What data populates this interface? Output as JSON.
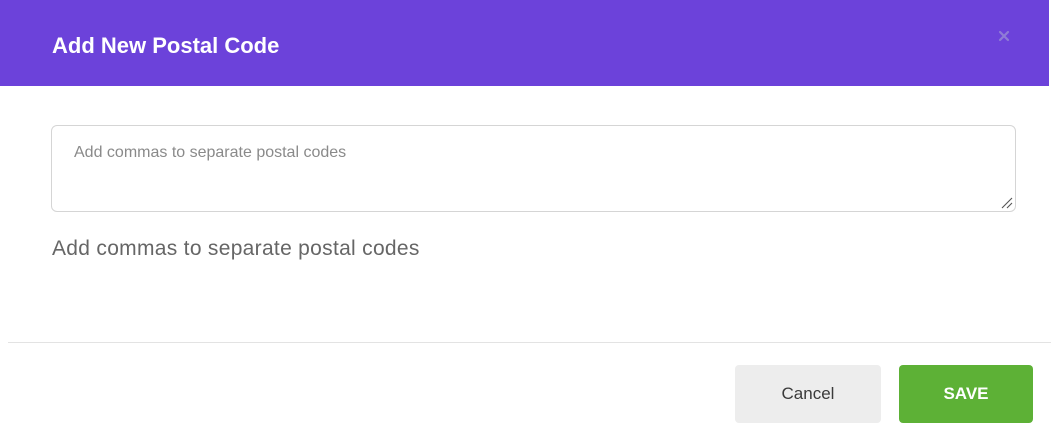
{
  "modal": {
    "title": "Add New Postal Code",
    "close_icon": "close-icon",
    "header_color": "#6c42da"
  },
  "form": {
    "postal_codes": {
      "value": "",
      "placeholder": "Add commas to separate postal codes"
    },
    "help_text": "Add commas to separate postal codes"
  },
  "footer": {
    "cancel_label": "Cancel",
    "save_label": "SAVE",
    "save_color": "#5db136"
  }
}
